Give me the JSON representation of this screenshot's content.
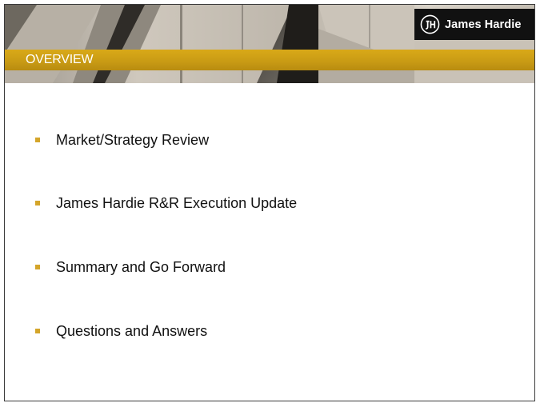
{
  "header": {
    "title": "OVERVIEW",
    "logo_text": "James Hardie",
    "logo_icon": "jh-monogram-icon"
  },
  "colors": {
    "title_bar": "#c89a14",
    "bullet": "#d4a52a",
    "logo_bg": "#111111",
    "border": "#3a3a3a"
  },
  "bullets": [
    "Market/Strategy Review",
    "James Hardie R&R Execution Update",
    "Summary and Go Forward",
    "Questions and Answers"
  ]
}
